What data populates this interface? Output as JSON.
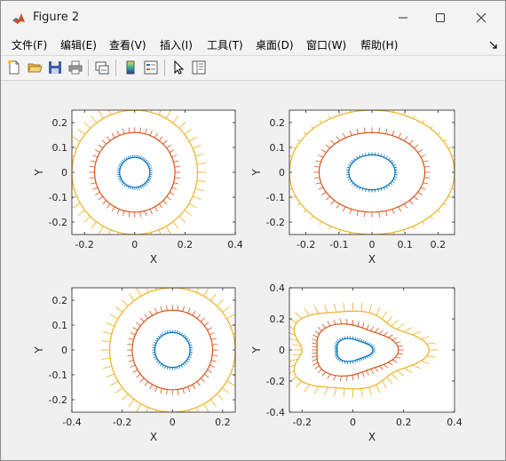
{
  "window": {
    "title": "Figure 2"
  },
  "menu": [
    "文件(F)",
    "编辑(E)",
    "查看(V)",
    "插入(I)",
    "工具(T)",
    "桌面(D)",
    "窗口(W)",
    "帮助(H)"
  ],
  "toolbar_icons": [
    "new-figure-icon",
    "open-folder-icon",
    "save-icon",
    "print-icon",
    "link-plot-icon",
    "colorbar-icon",
    "legend-icon",
    "pointer-icon",
    "property-inspector-icon"
  ],
  "colors": {
    "series1": "#0072BD",
    "series2": "#D95319",
    "series3": "#EDB120"
  },
  "chart_data": [
    {
      "type": "scatter",
      "xlabel": "X",
      "ylabel": "Y",
      "xlim": [
        -0.25,
        0.4
      ],
      "ylim": [
        -0.25,
        0.25
      ],
      "xticks": [
        "-0.2",
        "0",
        "0.2",
        "0.4"
      ],
      "yticks": [
        "0.2",
        "0.1",
        "0",
        "-0.1",
        "-0.2"
      ],
      "series": [
        {
          "radius": 0.06
        },
        {
          "radius": 0.16
        },
        {
          "radius": 0.25
        }
      ]
    },
    {
      "type": "scatter",
      "xlabel": "X",
      "ylabel": "Y",
      "xlim": [
        -0.25,
        0.25
      ],
      "ylim": [
        -0.25,
        0.25
      ],
      "xticks": [
        "-0.2",
        "-0.1",
        "0",
        "0.1",
        "0.2"
      ],
      "yticks": [
        "0.2",
        "0.1",
        "0",
        "-0.1",
        "-0.2"
      ],
      "series": [
        {
          "radius": 0.07
        },
        {
          "radius": 0.16
        },
        {
          "radius": 0.25
        }
      ]
    },
    {
      "type": "scatter",
      "xlabel": "X",
      "ylabel": "Y",
      "xlim": [
        -0.4,
        0.25
      ],
      "ylim": [
        -0.25,
        0.25
      ],
      "xticks": [
        "-0.4",
        "-0.2",
        "0",
        "0.2"
      ],
      "yticks": [
        "0.2",
        "0.1",
        "0",
        "-0.1",
        "-0.2"
      ],
      "series": [
        {
          "radius": 0.07
        },
        {
          "radius": 0.16
        },
        {
          "radius": 0.25
        }
      ]
    },
    {
      "type": "scatter",
      "xlabel": "X",
      "ylabel": "Y",
      "xlim": [
        -0.25,
        0.4
      ],
      "ylim": [
        -0.4,
        0.4
      ],
      "xticks": [
        "-0.2",
        "0",
        "0.2",
        "0.4"
      ],
      "yticks": [
        "0.4",
        "0.2",
        "0",
        "-0.2",
        "-0.4"
      ],
      "series": [
        {
          "radius": 0.07
        },
        {
          "radius": 0.16
        },
        {
          "radius": 0.25
        }
      ]
    }
  ]
}
